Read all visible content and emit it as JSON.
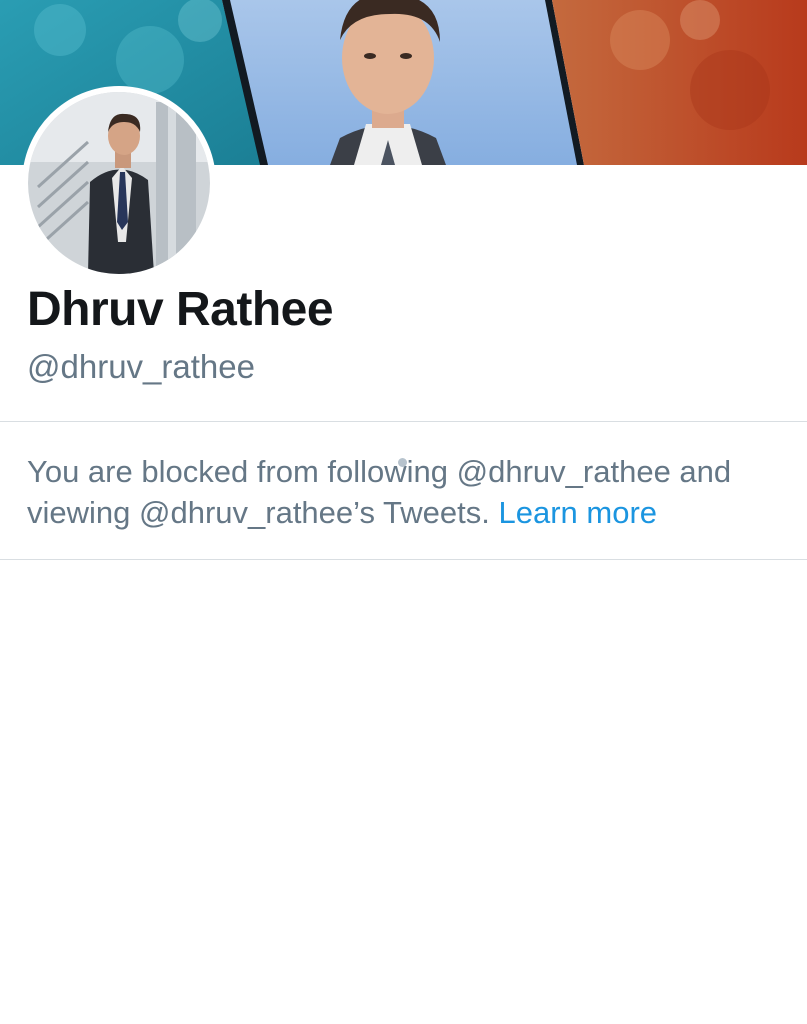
{
  "profile": {
    "display_name": "Dhruv Rathee",
    "handle": "@dhruv_rathee"
  },
  "blocked_notice": {
    "message": "You are blocked from following @dhruv_rathee and viewing @dhruv_rathee’s Tweets.",
    "link_label": "Learn more"
  },
  "colors": {
    "name_text": "#14171a",
    "secondary_text": "#657786",
    "link": "#1b95e0",
    "divider": "#d9dee2"
  },
  "images": {
    "banner": "profile-banner-photo",
    "avatar": "profile-avatar-photo"
  }
}
